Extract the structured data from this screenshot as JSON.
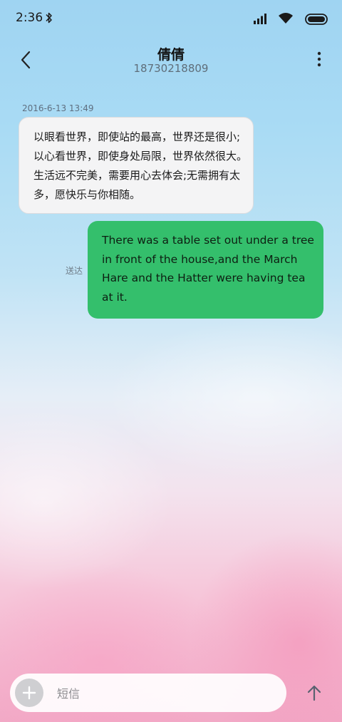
{
  "status_bar": {
    "time": "2:36",
    "icons": [
      "bluetooth-icon",
      "signal-icon",
      "wifi-icon",
      "battery-icon"
    ]
  },
  "header": {
    "contact_name": "倩倩",
    "contact_number": "18730218809",
    "back_icon": "back-arrow-icon",
    "more_icon": "more-vertical-icon"
  },
  "conversation": {
    "timestamp": "2016-6-13 13:49",
    "messages": [
      {
        "direction": "incoming",
        "text": "以眼看世界，即使站的最高，世界还是很小;以心看世界，即使身处局限，世界依然很大。生活远不完美，需要用心去体会;无需拥有太多，愿快乐与你相随。"
      },
      {
        "direction": "outgoing",
        "status": "送达",
        "text": "There was a table set out under a tree in front of the house,and the March Hare and the Hatter were having tea at it."
      }
    ]
  },
  "composer": {
    "placeholder": "短信",
    "add_icon": "plus-icon",
    "send_icon": "send-arrow-icon"
  },
  "colors": {
    "outgoing_bubble": "#34bf6c",
    "incoming_bubble": "#f4f4f5"
  }
}
